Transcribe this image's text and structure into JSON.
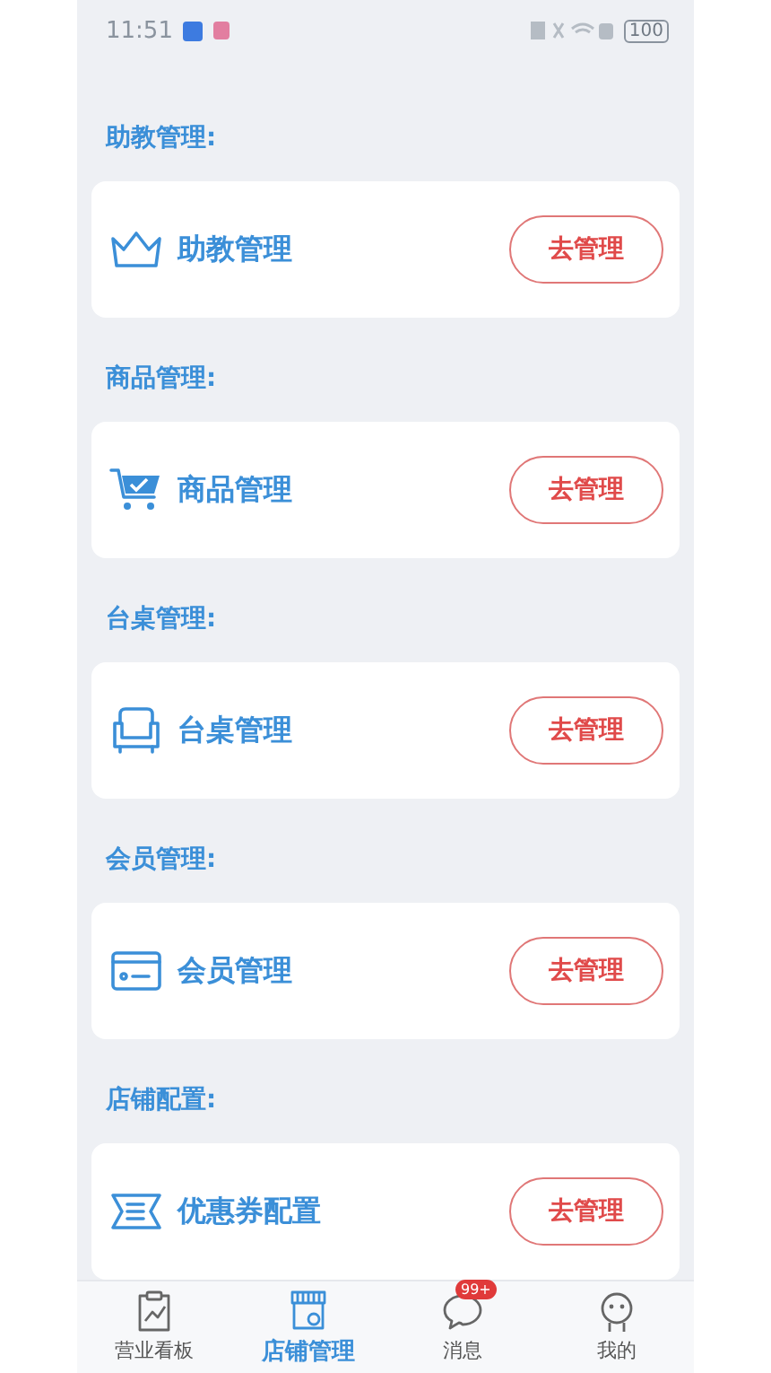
{
  "status_bar": {
    "time": "11:51",
    "battery": "100"
  },
  "sections": [
    {
      "heading": "助教管理:",
      "item": {
        "kind": "crown",
        "label": "助教管理",
        "button": "去管理"
      }
    },
    {
      "heading": "商品管理:",
      "item": {
        "kind": "cart",
        "label": "商品管理",
        "button": "去管理"
      }
    },
    {
      "heading": "台桌管理:",
      "item": {
        "kind": "sofa",
        "label": "台桌管理",
        "button": "去管理"
      }
    },
    {
      "heading": "会员管理:",
      "item": {
        "kind": "card",
        "label": "会员管理",
        "button": "去管理"
      }
    },
    {
      "heading": "店铺配置:",
      "item": {
        "kind": "ticket",
        "label": "优惠券配置",
        "button": "去管理"
      }
    }
  ],
  "tab_bar": [
    {
      "kind": "chart",
      "label": "营业看板",
      "selected": false
    },
    {
      "kind": "store",
      "label": "店铺管理",
      "selected": true
    },
    {
      "kind": "chat",
      "label": "消息",
      "selected": false,
      "badge": "99+"
    },
    {
      "kind": "face",
      "label": "我的",
      "selected": false
    }
  ]
}
